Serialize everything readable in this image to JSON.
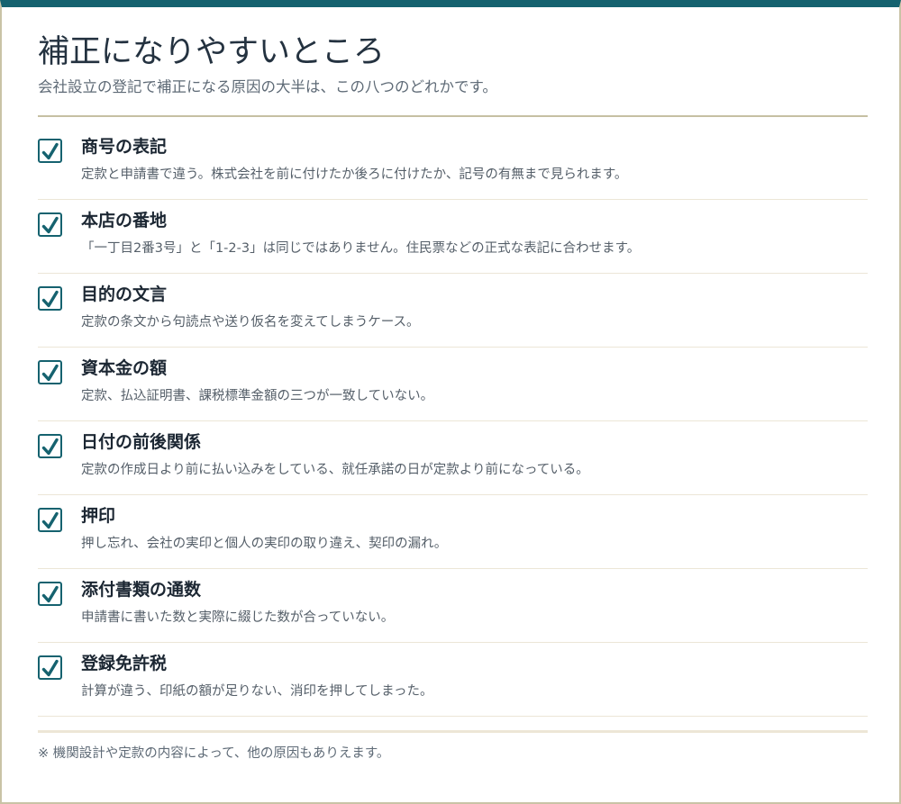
{
  "header": {
    "title": "補正になりやすいところ",
    "subtitle": "会社設立の登記で補正になる原因の大半は、この八つのどれかです。"
  },
  "colors": {
    "accent": "#15626f",
    "frame": "#c9c3a6",
    "divider": "#ece6d7"
  },
  "items": [
    {
      "title": "商号の表記",
      "desc": "定款と申請書で違う。株式会社を前に付けたか後ろに付けたか、記号の有無まで見られます。",
      "checked": true,
      "icon": "checkmark-icon"
    },
    {
      "title": "本店の番地",
      "desc": "「一丁目2番3号」と「1-2-3」は同じではありません。住民票などの正式な表記に合わせます。",
      "checked": true,
      "icon": "checkmark-icon"
    },
    {
      "title": "目的の文言",
      "desc": "定款の条文から句読点や送り仮名を変えてしまうケース。",
      "checked": true,
      "icon": "checkmark-icon"
    },
    {
      "title": "資本金の額",
      "desc": "定款、払込証明書、課税標準金額の三つが一致していない。",
      "checked": true,
      "icon": "checkmark-icon"
    },
    {
      "title": "日付の前後関係",
      "desc": "定款の作成日より前に払い込みをしている、就任承諾の日が定款より前になっている。",
      "checked": true,
      "icon": "checkmark-icon"
    },
    {
      "title": "押印",
      "desc": "押し忘れ、会社の実印と個人の実印の取り違え、契印の漏れ。",
      "checked": true,
      "icon": "checkmark-icon"
    },
    {
      "title": "添付書類の通数",
      "desc": "申請書に書いた数と実際に綴じた数が合っていない。",
      "checked": true,
      "icon": "checkmark-icon"
    },
    {
      "title": "登録免許税",
      "desc": "計算が違う、印紙の額が足りない、消印を押してしまった。",
      "checked": true,
      "icon": "checkmark-icon"
    }
  ],
  "footer": {
    "note": "※ 機関設計や定款の内容によって、他の原因もありえます。"
  }
}
